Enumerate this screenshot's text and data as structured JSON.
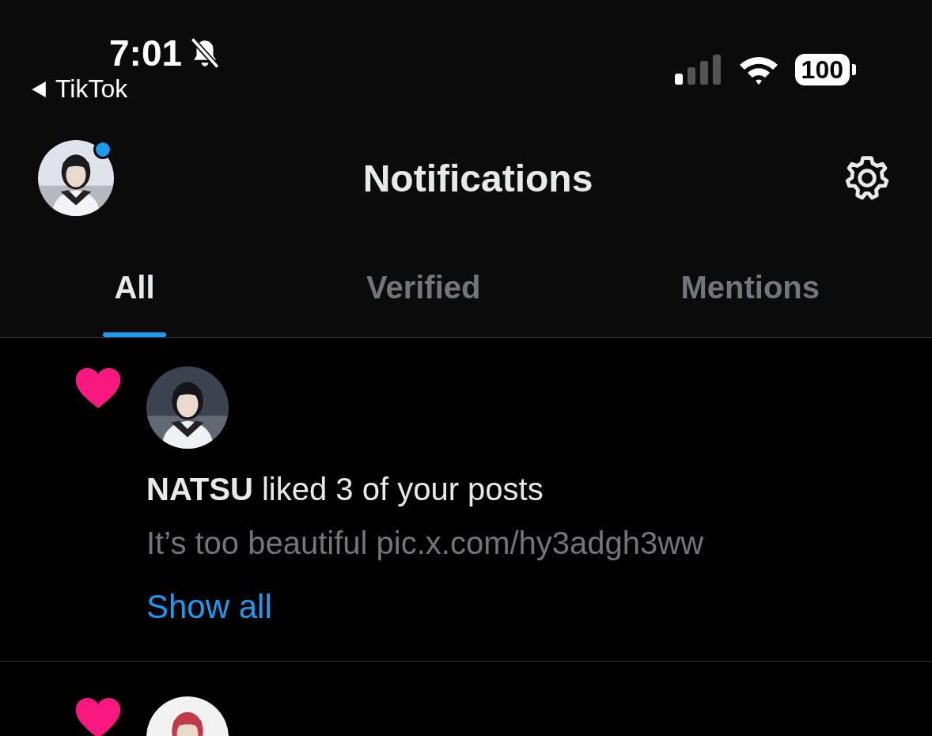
{
  "status_bar": {
    "time": "7:01",
    "silent": true,
    "back_label": "TikTok",
    "battery": "100"
  },
  "header": {
    "title": "Notifications",
    "avatar_badge": true
  },
  "tabs": [
    {
      "label": "All",
      "selected": true
    },
    {
      "label": "Verified",
      "selected": false
    },
    {
      "label": "Mentions",
      "selected": false
    }
  ],
  "notifications": [
    {
      "kind": "like",
      "message": "**NATSU** liked 3 of your posts",
      "preview": "It’s too beautiful pic.x.com/hy3adgh3ww",
      "link": "Show all"
    },
    {
      "kind": "like"
    }
  ]
}
